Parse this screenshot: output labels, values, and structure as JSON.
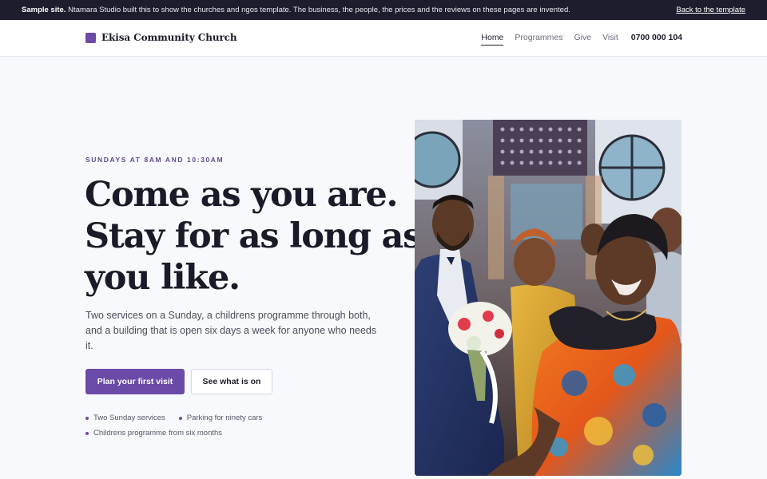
{
  "notice": {
    "lead": "Sample site.",
    "text": " Ntamara Studio built this to show the churches and ngos template. The business, the people, the prices and the reviews on these pages are invented.",
    "back_link": "Back to the template"
  },
  "header": {
    "brand_name": "Ekisa Community Church",
    "nav": [
      {
        "label": "Home",
        "active": true
      },
      {
        "label": "Programmes",
        "active": false
      },
      {
        "label": "Give",
        "active": false
      },
      {
        "label": "Visit",
        "active": false
      }
    ],
    "phone": "0700 000 104"
  },
  "hero": {
    "eyebrow": "SUNDAYS AT 8AM AND 10:30AM",
    "headline_lines": [
      "Come as you are.",
      "Stay for as long as",
      "you like."
    ],
    "lede": "Two services on a Sunday, a childrens programme through both, and a building that is open six days a week for anyone who needs it.",
    "primary_cta": "Plan your first visit",
    "secondary_cta": "See what is on",
    "features": [
      "Two Sunday services",
      "Parking for ninety cars",
      "Childrens programme from six months"
    ]
  },
  "photo": {
    "alt": "Congregation members smiling in the church aisle"
  },
  "colors": {
    "accent": "#6b4aa8",
    "notice_bg": "#1d1d2e",
    "page_bg": "#f8f9fc"
  }
}
